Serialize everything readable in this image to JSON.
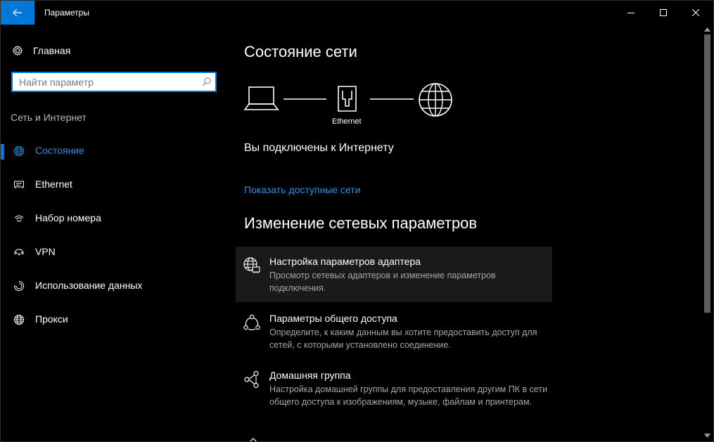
{
  "window": {
    "title": "Параметры",
    "back_icon": "arrow-left-icon",
    "minimize_icon": "minimize-icon",
    "maximize_icon": "maximize-icon",
    "close_icon": "close-icon"
  },
  "sidebar": {
    "home_label": "Главная",
    "search_placeholder": "Найти параметр",
    "section_header": "Сеть и Интернет",
    "items": [
      {
        "label": "Состояние",
        "icon": "globe-icon",
        "active": true
      },
      {
        "label": "Ethernet",
        "icon": "ethernet-icon",
        "active": false
      },
      {
        "label": "Набор номера",
        "icon": "dialup-icon",
        "active": false
      },
      {
        "label": "VPN",
        "icon": "vpn-icon",
        "active": false
      },
      {
        "label": "Использование данных",
        "icon": "data-usage-icon",
        "active": false
      },
      {
        "label": "Прокси",
        "icon": "proxy-globe-icon",
        "active": false
      }
    ]
  },
  "main": {
    "title": "Состояние сети",
    "network_label": "Ethernet",
    "status_text": "Вы подключены к Интернету",
    "show_networks_link": "Показать доступные сети",
    "change_section_title": "Изменение сетевых параметров",
    "settings": [
      {
        "title": "Настройка параметров адаптера",
        "desc": "Просмотр сетевых адаптеров и изменение параметров подключения.",
        "icon": "adapter-icon"
      },
      {
        "title": "Параметры общего доступа",
        "desc": "Определите, к каким данным вы хотите предоставить доступ для сетей, с которыми установлено соединение.",
        "icon": "sharing-icon"
      },
      {
        "title": "Домашняя группа",
        "desc": "Настройка домашней группы для предоставления другим ПК в сети общего доступа к изображениям, музыке, файлам и принтерам.",
        "icon": "homegroup-icon"
      }
    ]
  },
  "colors": {
    "accent": "#0078d7",
    "link": "#2d8ee0",
    "background": "#000000"
  }
}
